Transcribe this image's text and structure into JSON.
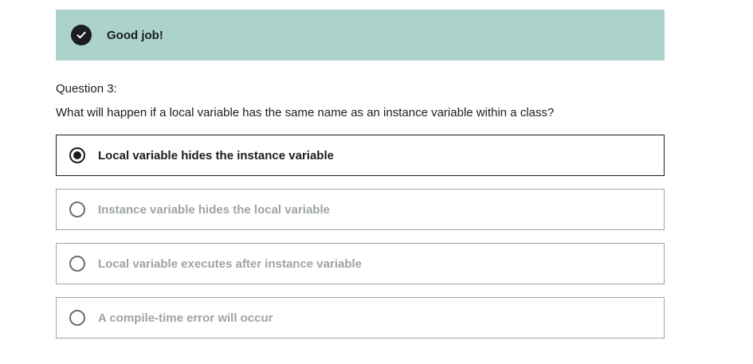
{
  "feedback": {
    "icon": "check-circle-icon",
    "message": "Good job!",
    "background_color": "#acd2cc"
  },
  "question": {
    "label": "Question 3:",
    "text": "What will happen if a local variable has the same name as an instance variable within a class?"
  },
  "options": [
    {
      "label": "Local variable hides the instance variable",
      "selected": true
    },
    {
      "label": "Instance variable hides the local variable",
      "selected": false
    },
    {
      "label": "Local variable executes after instance variable",
      "selected": false
    },
    {
      "label": "A compile-time error will occur",
      "selected": false
    }
  ]
}
